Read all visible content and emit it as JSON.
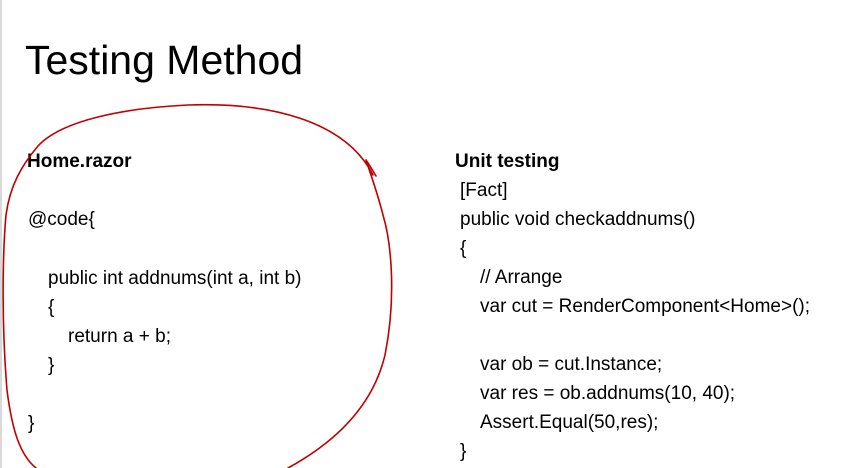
{
  "slide": {
    "title": "Testing Method"
  },
  "left_panel": {
    "heading": "Home.razor",
    "lines": [
      "@code{",
      "public int addnums(int a, int b)",
      "{",
      "return a + b;",
      "}",
      "}"
    ]
  },
  "right_panel": {
    "heading": "Unit testing",
    "lines": [
      "[Fact]",
      "public void checkaddnums()",
      "{",
      "// Arrange",
      "var cut = RenderComponent<Home>();",
      "var ob = cut.Instance;",
      "var res = ob.addnums(10, 40);",
      "Assert.Equal(50,res);",
      "}"
    ]
  },
  "annotation": {
    "color": "#c00000"
  }
}
